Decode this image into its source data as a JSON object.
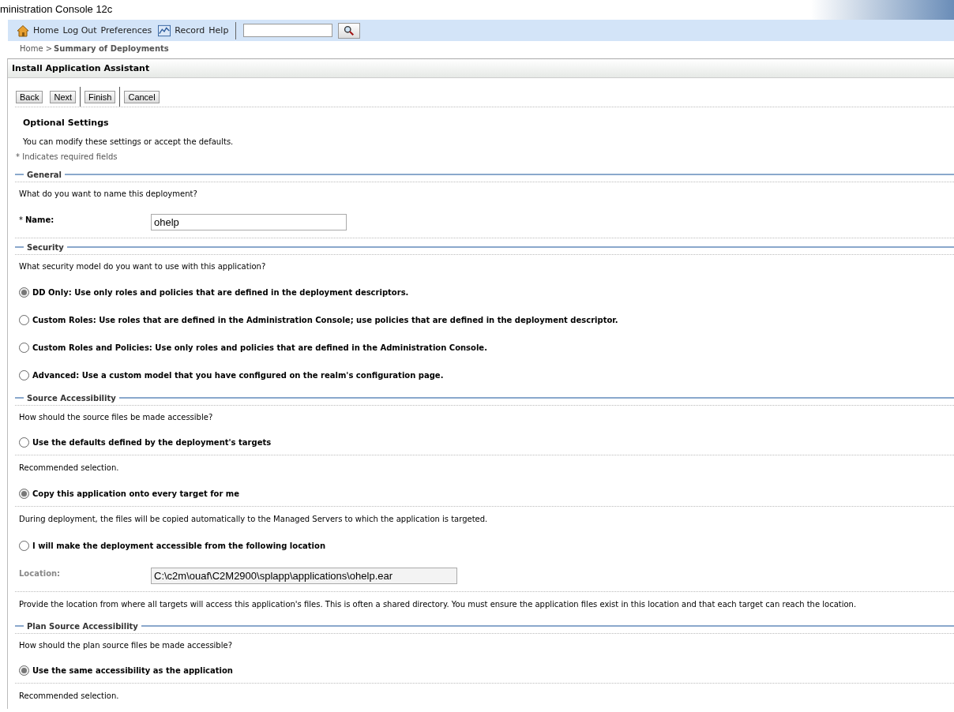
{
  "window": {
    "title": "ministration Console 12c"
  },
  "toolbar": {
    "links": [
      {
        "label": "Home",
        "kind": "home"
      },
      {
        "label": "Log Out",
        "kind": "plain"
      },
      {
        "label": "Preferences",
        "kind": "plain"
      },
      {
        "label": "Record",
        "kind": "chart"
      },
      {
        "label": "Help",
        "kind": "plain"
      }
    ]
  },
  "breadcrumb": {
    "link": "Home >",
    "current": "Summary of Deployments"
  },
  "panel": {
    "title": "Install Application Assistant",
    "buttons": [
      {
        "label": "Back",
        "separator_before": false
      },
      {
        "label": "Next",
        "separator_before": false
      },
      {
        "label": "Finish",
        "separator_before": true
      },
      {
        "label": "Cancel",
        "separator_before": true
      }
    ],
    "heading": "Optional Settings",
    "description": "You can modify these settings or accept the defaults.",
    "required_note": "* Indicates required fields",
    "sections": [
      {
        "title": "General",
        "question": "What do you want to name this deployment?",
        "items": [
          {
            "kind": "field",
            "required_mark": "*",
            "label": "Name:",
            "disabled": false,
            "value": "ohelp"
          }
        ]
      },
      {
        "title": "Security",
        "question": "What security model do you want to use with this application?",
        "items": [
          {
            "kind": "radio",
            "label": "DD Only: Use only roles and policies that are defined in the deployment descriptors.",
            "selected": true
          },
          {
            "kind": "radio",
            "label": "Custom Roles: Use roles that are defined in the Administration Console; use policies that are defined in the deployment descriptor.",
            "selected": false
          },
          {
            "kind": "radio",
            "label": "Custom Roles and Policies: Use only roles and policies that are defined in the Administration Console.",
            "selected": false
          },
          {
            "kind": "radio",
            "label": "Advanced: Use a custom model that you have configured on the realm's configuration page.",
            "selected": false
          }
        ]
      },
      {
        "title": "Source Accessibility",
        "question": "How should the source files be made accessible?",
        "items": [
          {
            "kind": "radio",
            "label": "Use the defaults defined by the deployment's targets",
            "selected": false
          },
          {
            "kind": "note",
            "text": "Recommended selection."
          },
          {
            "kind": "radio",
            "label": "Copy this application onto every target for me",
            "selected": true
          },
          {
            "kind": "note",
            "text": "During deployment, the files will be copied automatically to the Managed Servers to which the application is targeted."
          },
          {
            "kind": "radio",
            "label": "I will make the deployment accessible from the following location",
            "selected": false
          },
          {
            "kind": "field",
            "label": "Location:",
            "disabled": true,
            "value": "C:\\c2m\\ouaf\\C2M2900\\splapp\\applications\\ohelp.ear"
          },
          {
            "kind": "note",
            "text": "Provide the location from where all targets will access this application's files. This is often a shared directory. You must ensure the application files exist in this location and that each target can reach the location."
          }
        ]
      },
      {
        "title": "Plan Source Accessibility",
        "question": "How should the plan source files be made accessible?",
        "items": [
          {
            "kind": "radio",
            "label": "Use the same accessibility as the application",
            "selected": true
          },
          {
            "kind": "note",
            "text": "Recommended selection."
          }
        ]
      }
    ]
  }
}
